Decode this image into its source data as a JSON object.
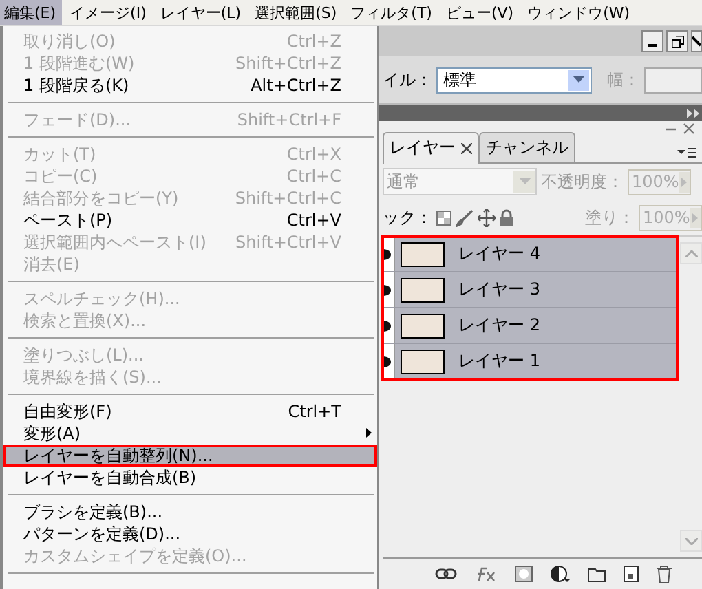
{
  "menubar": [
    {
      "label": "編集(E)",
      "selected": true
    },
    {
      "label": "イメージ(I)",
      "selected": false
    },
    {
      "label": "レイヤー(L)",
      "selected": false
    },
    {
      "label": "選択範囲(S)",
      "selected": false
    },
    {
      "label": "フィルタ(T)",
      "selected": false
    },
    {
      "label": "ビュー(V)",
      "selected": false
    },
    {
      "label": "ウィンドウ(W)",
      "selected": false
    }
  ],
  "menu": [
    {
      "kind": "item",
      "label": "取り消し(O)",
      "shortcut": "Ctrl+Z",
      "disabled": true,
      "selected": false
    },
    {
      "kind": "item",
      "label": "1 段階進む(W)",
      "shortcut": "Shift+Ctrl+Z",
      "disabled": true,
      "selected": false
    },
    {
      "kind": "item",
      "label": "1 段階戻る(K)",
      "shortcut": "Alt+Ctrl+Z",
      "disabled": false,
      "selected": false
    },
    {
      "kind": "separator"
    },
    {
      "kind": "item",
      "label": "フェード(D)...",
      "shortcut": "Shift+Ctrl+F",
      "disabled": true,
      "selected": false
    },
    {
      "kind": "separator"
    },
    {
      "kind": "item",
      "label": "カット(T)",
      "shortcut": "Ctrl+X",
      "disabled": true,
      "selected": false
    },
    {
      "kind": "item",
      "label": "コピー(C)",
      "shortcut": "Ctrl+C",
      "disabled": true,
      "selected": false
    },
    {
      "kind": "item",
      "label": "結合部分をコピー(Y)",
      "shortcut": "Shift+Ctrl+C",
      "disabled": true,
      "selected": false
    },
    {
      "kind": "item",
      "label": "ペースト(P)",
      "shortcut": "Ctrl+V",
      "disabled": false,
      "selected": false
    },
    {
      "kind": "item",
      "label": "選択範囲内へペースト(I)",
      "shortcut": "Shift+Ctrl+V",
      "disabled": true,
      "selected": false
    },
    {
      "kind": "item",
      "label": "消去(E)",
      "disabled": true,
      "selected": false
    },
    {
      "kind": "separator"
    },
    {
      "kind": "item",
      "label": "スペルチェック(H)...",
      "disabled": true,
      "selected": false
    },
    {
      "kind": "item",
      "label": "検索と置換(X)...",
      "disabled": true,
      "selected": false
    },
    {
      "kind": "separator"
    },
    {
      "kind": "item",
      "label": "塗りつぶし(L)...",
      "disabled": true,
      "selected": false
    },
    {
      "kind": "item",
      "label": "境界線を描く(S)...",
      "disabled": true,
      "selected": false
    },
    {
      "kind": "separator"
    },
    {
      "kind": "item",
      "label": "自由変形(F)",
      "shortcut": "Ctrl+T",
      "disabled": false,
      "selected": false
    },
    {
      "kind": "submenu",
      "label": "変形(A)",
      "disabled": false,
      "selected": false
    },
    {
      "kind": "item",
      "label": "レイヤーを自動整列(N)...",
      "disabled": false,
      "selected": true,
      "outlined": true
    },
    {
      "kind": "item",
      "label": "レイヤーを自動合成(B)",
      "disabled": false,
      "selected": false
    },
    {
      "kind": "separator"
    },
    {
      "kind": "item",
      "label": "ブラシを定義(B)...",
      "disabled": false,
      "selected": false
    },
    {
      "kind": "item",
      "label": "パターンを定義(D)...",
      "disabled": false,
      "selected": false
    },
    {
      "kind": "item",
      "label": "カスタムシェイプを定義(O)...",
      "disabled": true,
      "selected": false
    },
    {
      "kind": "separator"
    }
  ],
  "options_bar": {
    "style_label": "イル：",
    "style_value": "標準",
    "width_label": "幅："
  },
  "panel": {
    "tabs": [
      {
        "label": "レイヤー",
        "selected": true
      },
      {
        "label": "チャンネル",
        "selected": false
      }
    ],
    "blend_mode": "通常",
    "opacity_label": "不透明度：",
    "opacity": "100%",
    "lock_label": "ック：",
    "fill_label": "塗り：",
    "fill": "100%",
    "outlined": true,
    "layers": [
      {
        "name": "レイヤー 4",
        "visible": true,
        "selected": true
      },
      {
        "name": "レイヤー 3",
        "visible": true,
        "selected": true
      },
      {
        "name": "レイヤー 2",
        "visible": true,
        "selected": true
      },
      {
        "name": "レイヤー 1",
        "visible": true,
        "selected": true
      }
    ]
  }
}
